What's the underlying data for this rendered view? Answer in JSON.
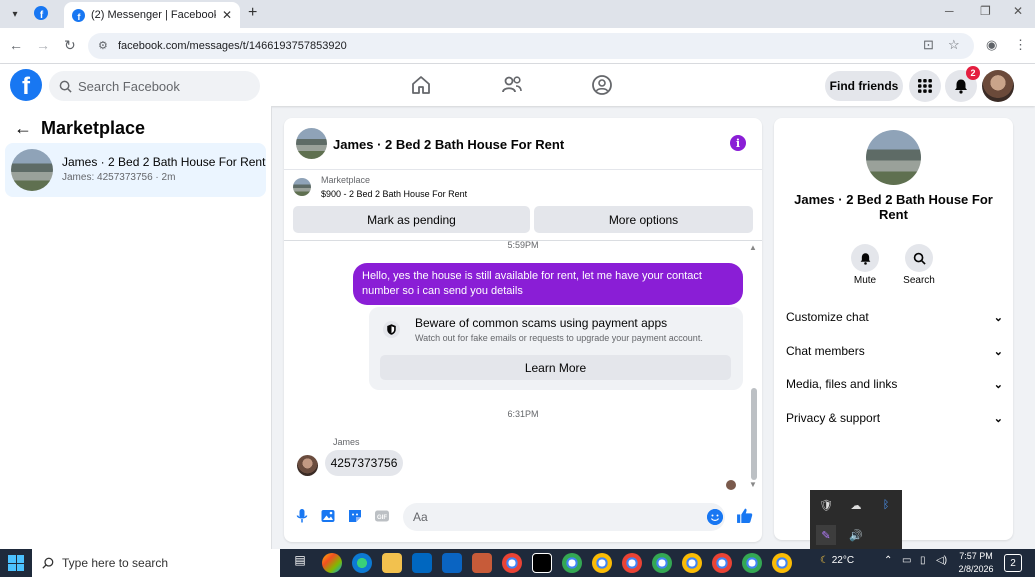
{
  "browser": {
    "tab_title": "(2) Messenger | Facebook",
    "url": "facebook.com/messages/t/1466193757853920"
  },
  "fb_header": {
    "search_placeholder": "Search Facebook",
    "find_friends_label": "Find friends",
    "notification_count": "2"
  },
  "sidebar": {
    "title": "Marketplace",
    "conversation": {
      "name": "James · 2 Bed 2 Bath House For Rent",
      "preview": "James: 4257373756 · 2m"
    }
  },
  "chat": {
    "title": "James · 2 Bed 2 Bath House For Rent",
    "marketplace_label": "Marketplace",
    "listing": "$900 - 2 Bed 2 Bath House For Rent",
    "mark_pending_label": "Mark as pending",
    "more_options_label": "More options",
    "time_1": "5:59PM",
    "outgoing_message": "Hello, yes the house is still available for rent, let me have your contact number so i can send you  details",
    "scam_title": "Beware of common scams using payment apps",
    "scam_subtitle": "Watch out for fake emails or requests to upgrade your payment account.",
    "learn_more_label": "Learn More",
    "time_2": "6:31PM",
    "sender_name": "James",
    "incoming_message": "4257373756",
    "composer_placeholder": "Aa"
  },
  "right_panel": {
    "title": "James · 2 Bed 2 Bath House For Rent",
    "mute_label": "Mute",
    "search_label": "Search",
    "rows": [
      "Customize chat",
      "Chat members",
      "Media, files and links",
      "Privacy & support"
    ]
  },
  "taskbar": {
    "search_placeholder": "Type here to search",
    "weather": "22°C",
    "time": "7:57 PM",
    "date": "2/8/2026",
    "notification_count": "2"
  },
  "colors": {
    "fb_blue": "#1877f2",
    "message_purple": "#8a1ed6",
    "notification_red": "#e41e3f"
  }
}
